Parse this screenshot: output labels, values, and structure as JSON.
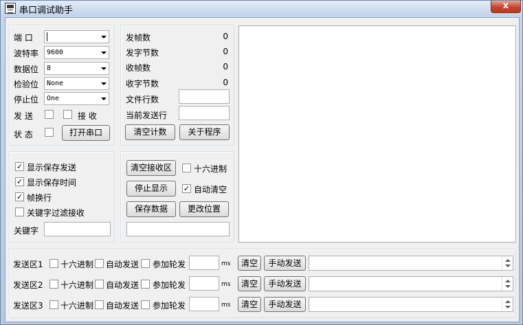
{
  "window": {
    "title": "串口调试助手",
    "close_glyph": "x"
  },
  "settings": {
    "port_label": "端  口",
    "baud_label": "波特率",
    "baud_value": "9600",
    "databits_label": "数据位",
    "databits_value": "8",
    "parity_label": "检验位",
    "parity_value": "None",
    "stopbits_label": "停止位",
    "stopbits_value": "One",
    "send_label": "发  送",
    "recv_label": "接  收",
    "status_label": "状  态",
    "open_port_button": "打开串口"
  },
  "counters": {
    "frames_sent_label": "发帧数",
    "frames_sent_value": "0",
    "bytes_sent_label": "发字节数",
    "bytes_sent_value": "0",
    "frames_recv_label": "收帧数",
    "frames_recv_value": "0",
    "bytes_recv_label": "收字节数",
    "bytes_recv_value": "0",
    "file_lines_label": "文件行数",
    "current_line_label": "当前发送行",
    "clear_counts_button": "清空计数",
    "about_button": "关于程序"
  },
  "display_options": {
    "show_save_send": "显示保存发送",
    "show_save_time": "显示保存时间",
    "frame_newline": "帧换行",
    "keyword_filter": "关键字过滤接收",
    "keyword_label": "关键字"
  },
  "receive_controls": {
    "clear_recv_button": "清空接收区",
    "hex_label": "十六进制",
    "stop_display_button": "停止显示",
    "auto_clear_label": "自动清空",
    "save_data_button": "保存数据",
    "change_location_button": "更改位置"
  },
  "send_rows": [
    {
      "label": "发送区1",
      "hex": "十六进制",
      "auto_send": "自动发送",
      "poll": "参加轮发",
      "unit": "ms",
      "clear": "清空",
      "manual": "手动发送"
    },
    {
      "label": "发送区2",
      "hex": "十六进制",
      "auto_send": "自动发送",
      "poll": "参加轮发",
      "unit": "ms",
      "clear": "清空",
      "manual": "手动发送"
    },
    {
      "label": "发送区3",
      "hex": "十六进制",
      "auto_send": "自动发送",
      "poll": "参加轮发",
      "unit": "ms",
      "clear": "清空",
      "manual": "手动发送"
    }
  ],
  "check_glyph": "✓"
}
